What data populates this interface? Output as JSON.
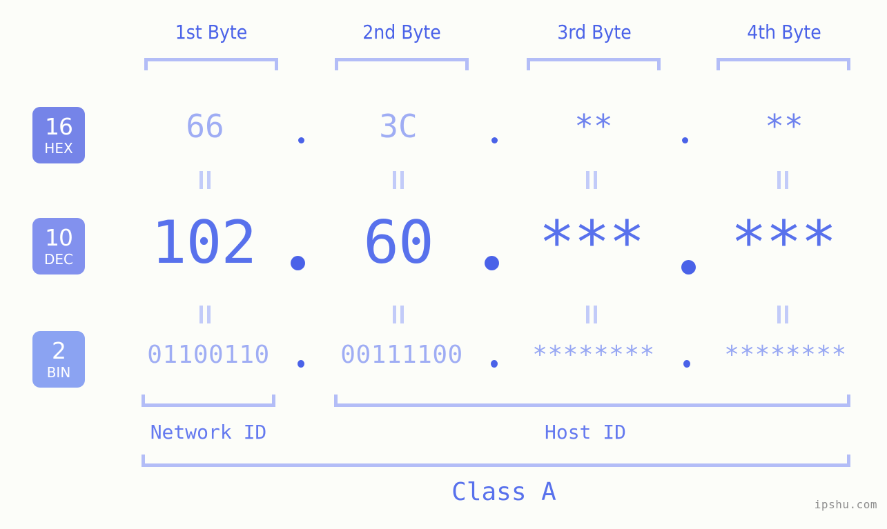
{
  "background_color": "#fcfdf9",
  "accent_color": "#4a62e8",
  "palette": {
    "header_text": "#4a62e8",
    "bracket": "#b3bdf7",
    "hex_value": "#9fadf4",
    "dec_value": "#5871ec",
    "bin_value": "#9fadf4",
    "badge_hex": "#7584e8",
    "badge_dec": "#8291ee",
    "badge_bin": "#8ba3f2",
    "equals_mark": "#c2cbf9",
    "watermark": "#8e8e8e"
  },
  "byte_headers": [
    {
      "label": "1st Byte"
    },
    {
      "label": "2nd Byte"
    },
    {
      "label": "3rd Byte"
    },
    {
      "label": "4th Byte"
    }
  ],
  "radix_badges": [
    {
      "number": "16",
      "system": "HEX"
    },
    {
      "number": "10",
      "system": "DEC"
    },
    {
      "number": "2",
      "system": "BIN"
    }
  ],
  "rows": {
    "hex": {
      "values": [
        "66",
        "3C",
        "**",
        "**"
      ],
      "masked": [
        false,
        false,
        true,
        true
      ]
    },
    "dec": {
      "values": [
        "102",
        "60",
        "***",
        "***"
      ],
      "masked": [
        false,
        false,
        true,
        true
      ]
    },
    "bin": {
      "values": [
        "01100110",
        "00111100",
        "********",
        "********"
      ],
      "masked": [
        false,
        false,
        true,
        true
      ]
    }
  },
  "separators": {
    "symbol": ".",
    "count": 3
  },
  "equals_marks": {
    "symbol": "=",
    "rows": 2,
    "columns": 4
  },
  "id_captions": [
    {
      "label": "Network ID",
      "span": "1st byte"
    },
    {
      "label": "Host ID",
      "span": "2nd-4th bytes"
    }
  ],
  "class_caption": {
    "label": "Class A",
    "span": "all 4 bytes"
  },
  "watermark": {
    "text": "ipshu.com"
  }
}
